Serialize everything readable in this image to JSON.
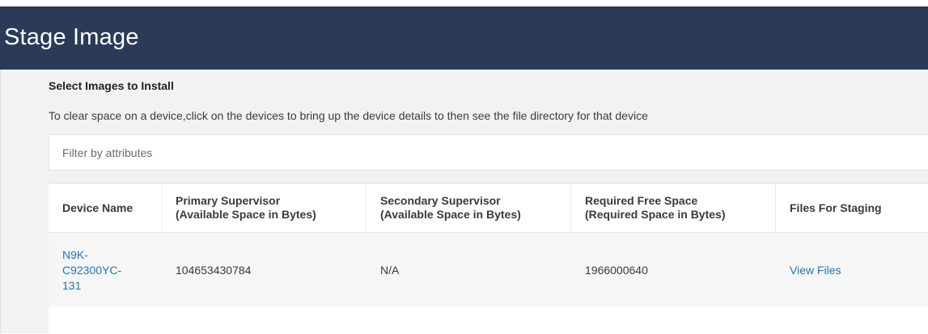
{
  "header": {
    "title": "Stage Image"
  },
  "section": {
    "title": "Select Images to Install",
    "instructions": "To clear space on a device,click on the devices to bring up the device details to then see the file directory for that device"
  },
  "filter": {
    "placeholder": "Filter by attributes",
    "value": ""
  },
  "table": {
    "columns": [
      {
        "line1": "Device Name",
        "line2": ""
      },
      {
        "line1": "Primary Supervisor",
        "line2": "(Available Space in Bytes)"
      },
      {
        "line1": "Secondary Supervisor",
        "line2": "(Available Space in Bytes)"
      },
      {
        "line1": "Required Free Space",
        "line2": "(Required Space in Bytes)"
      },
      {
        "line1": "Files For Staging",
        "line2": ""
      }
    ],
    "rows": [
      {
        "device_name_lines": [
          "N9K-",
          "C92300YC-",
          "131"
        ],
        "primary": "104653430784",
        "secondary": "N/A",
        "required": "1966000640",
        "files_link": "View Files"
      }
    ]
  },
  "colors": {
    "header_bg": "#2a3a57",
    "link": "#2773b0",
    "content_bg": "#f2f2f2"
  }
}
